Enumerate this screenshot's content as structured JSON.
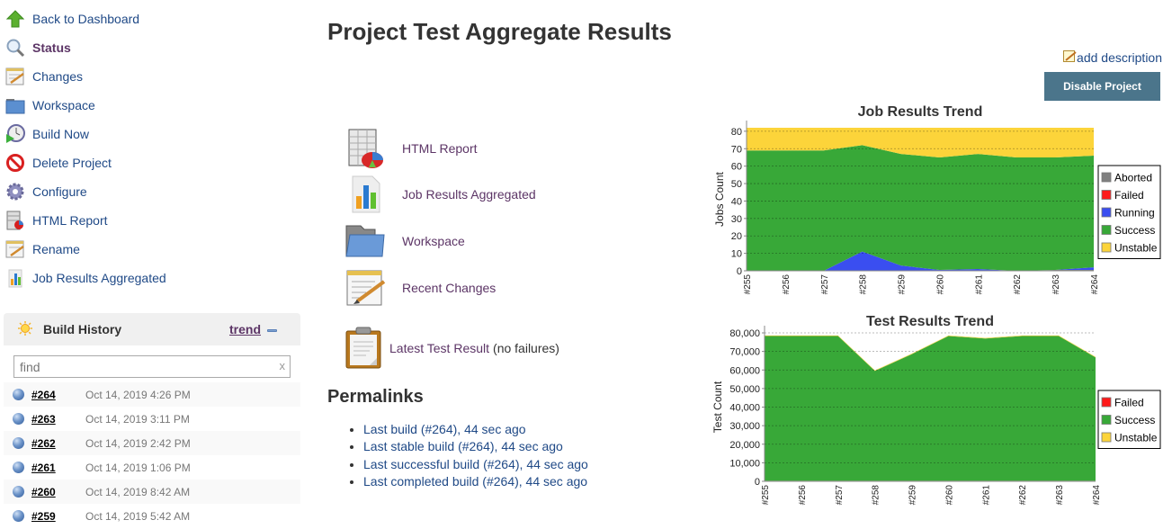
{
  "sidebar": {
    "items": [
      {
        "label": "Back to Dashboard",
        "icon": "up-arrow-icon"
      },
      {
        "label": "Status",
        "icon": "magnifier-icon"
      },
      {
        "label": "Changes",
        "icon": "notepad-icon"
      },
      {
        "label": "Workspace",
        "icon": "folder-icon"
      },
      {
        "label": "Build Now",
        "icon": "clock-play-icon"
      },
      {
        "label": "Delete Project",
        "icon": "no-entry-icon"
      },
      {
        "label": "Configure",
        "icon": "gear-icon"
      },
      {
        "label": "HTML Report",
        "icon": "report-icon"
      },
      {
        "label": "Rename",
        "icon": "notepad-icon"
      },
      {
        "label": "Job Results Aggregated",
        "icon": "bar-chart-icon"
      }
    ]
  },
  "build_history": {
    "title": "Build History",
    "trend_label": "trend",
    "search_placeholder": "find",
    "clear_label": "x",
    "builds": [
      {
        "number": "#264",
        "date": "Oct 14, 2019 4:26 PM"
      },
      {
        "number": "#263",
        "date": "Oct 14, 2019 3:11 PM"
      },
      {
        "number": "#262",
        "date": "Oct 14, 2019 2:42 PM"
      },
      {
        "number": "#261",
        "date": "Oct 14, 2019 1:06 PM"
      },
      {
        "number": "#260",
        "date": "Oct 14, 2019 8:42 AM"
      },
      {
        "number": "#259",
        "date": "Oct 14, 2019 5:42 AM"
      }
    ]
  },
  "main": {
    "title": "Project Test Aggregate Results",
    "add_description": "add description",
    "disable_button": "Disable Project",
    "links": [
      {
        "label": "HTML Report",
        "icon": "html-report-icon"
      },
      {
        "label": "Job Results Aggregated",
        "icon": "bar-chart-icon"
      },
      {
        "label": "Workspace",
        "icon": "folder-icon"
      },
      {
        "label": "Recent Changes",
        "icon": "notepad-icon"
      }
    ],
    "latest_test": {
      "label": "Latest Test Result",
      "note": "(no failures)"
    },
    "permalinks_heading": "Permalinks",
    "permalinks": [
      "Last build (#264), 44 sec ago",
      "Last stable build (#264), 44 sec ago",
      "Last successful build (#264), 44 sec ago",
      "Last completed build (#264), 44 sec ago"
    ]
  },
  "colors": {
    "aborted": "#808080",
    "failed": "#ff1a1a",
    "running": "#3a4ef0",
    "success": "#38a838",
    "unstable": "#fcd43a",
    "link": "#204a87",
    "visited": "#5c3566",
    "button": "#4b758b"
  },
  "chart_data": [
    {
      "type": "area",
      "title": "Job Results Trend",
      "xlabel": "",
      "ylabel": "Jobs Count",
      "categories": [
        "#255",
        "#256",
        "#257",
        "#258",
        "#259",
        "#260",
        "#261",
        "#262",
        "#263",
        "#264"
      ],
      "ylim": [
        0,
        82
      ],
      "yticks": [
        0,
        10,
        20,
        30,
        40,
        50,
        60,
        70,
        80
      ],
      "grid": true,
      "legend": "right",
      "stacked": true,
      "series": [
        {
          "name": "Aborted",
          "color": "#808080",
          "values": [
            0,
            0,
            0,
            0,
            0,
            0,
            0,
            0,
            0.5,
            0.5
          ]
        },
        {
          "name": "Failed",
          "color": "#ff1a1a",
          "values": [
            0,
            0,
            0,
            0,
            0,
            0,
            0,
            0,
            0,
            0
          ]
        },
        {
          "name": "Running",
          "color": "#3a4ef0",
          "values": [
            0,
            0,
            0,
            11,
            3,
            0.5,
            1,
            0,
            0,
            1.5
          ]
        },
        {
          "name": "Success",
          "color": "#38a838",
          "values": [
            69,
            69,
            69,
            61,
            64,
            64.5,
            66,
            65,
            64.5,
            64
          ]
        },
        {
          "name": "Unstable",
          "color": "#fcd43a",
          "values": [
            13,
            13,
            13,
            10,
            15,
            17,
            15,
            17,
            17,
            16
          ]
        }
      ]
    },
    {
      "type": "area",
      "title": "Test Results Trend",
      "xlabel": "",
      "ylabel": "Test Count",
      "categories": [
        "#255",
        "#256",
        "#257",
        "#258",
        "#259",
        "#260",
        "#261",
        "#262",
        "#263",
        "#264"
      ],
      "ylim": [
        0,
        80000
      ],
      "yticks": [
        0,
        10000,
        20000,
        30000,
        40000,
        50000,
        60000,
        70000,
        80000
      ],
      "ytick_labels": [
        "0",
        "10,000",
        "20,000",
        "30,000",
        "40,000",
        "50,000",
        "60,000",
        "70,000",
        "80,000"
      ],
      "grid": true,
      "legend": "right",
      "stacked": true,
      "series": [
        {
          "name": "Failed",
          "color": "#ff1a1a",
          "values": [
            300,
            300,
            300,
            300,
            300,
            300,
            300,
            300,
            300,
            300
          ]
        },
        {
          "name": "Success",
          "color": "#38a838",
          "values": [
            78000,
            78000,
            78000,
            59200,
            68200,
            78000,
            76700,
            78000,
            78000,
            66500
          ]
        },
        {
          "name": "Unstable",
          "color": "#fcd43a",
          "values": [
            300,
            300,
            300,
            300,
            300,
            300,
            300,
            300,
            300,
            300
          ]
        }
      ]
    }
  ]
}
